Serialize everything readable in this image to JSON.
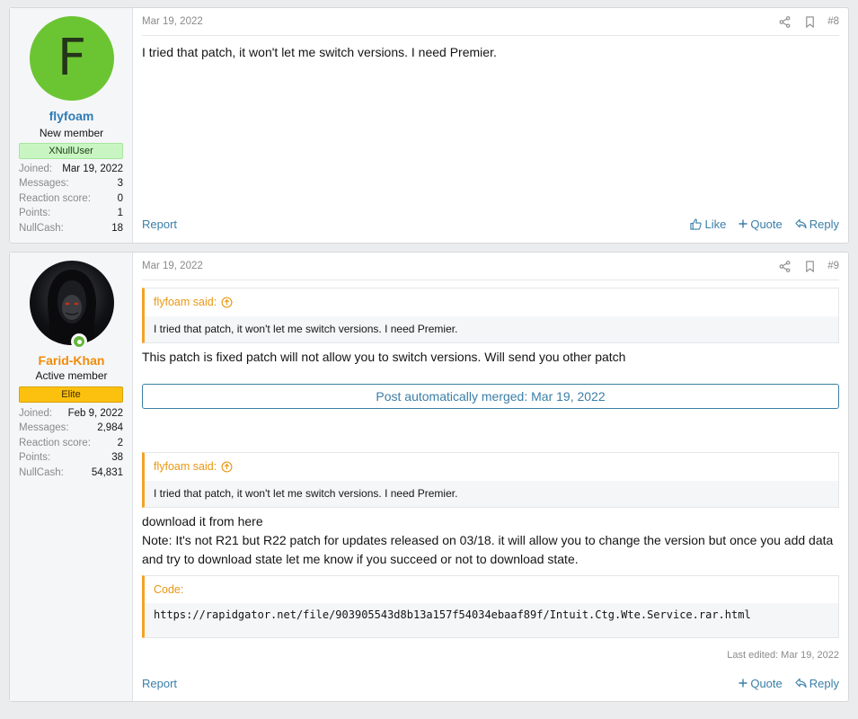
{
  "colors": {
    "link": "#3a7fa8",
    "quote_accent": "#f3a225",
    "avatar_green": "#6bc533",
    "badge_xnull_bg": "#c9f5c3",
    "badge_elite_bg": "#fcc10f",
    "username_blue": "#2f7cb5",
    "username_orange": "#f08c0a"
  },
  "posts": [
    {
      "date": "Mar 19, 2022",
      "number": "#8",
      "user": {
        "avatar_letter": "F",
        "name": "flyfoam",
        "title": "New member",
        "badge": "XNullUser",
        "stats": [
          {
            "label": "Joined:",
            "value": "Mar 19, 2022"
          },
          {
            "label": "Messages:",
            "value": "3"
          },
          {
            "label": "Reaction score:",
            "value": "0"
          },
          {
            "label": "Points:",
            "value": "1"
          },
          {
            "label": "NullCash:",
            "value": "18"
          }
        ]
      },
      "body": "I tried that patch, it won't let me switch versions. I need Premier.",
      "footer": {
        "report": "Report",
        "like": "Like",
        "quote": "Quote",
        "reply": "Reply"
      }
    },
    {
      "date": "Mar 19, 2022",
      "number": "#9",
      "user": {
        "name": "Farid-Khan",
        "title": "Active member",
        "badge": "Elite",
        "stats": [
          {
            "label": "Joined:",
            "value": "Feb 9, 2022"
          },
          {
            "label": "Messages:",
            "value": "2,984"
          },
          {
            "label": "Reaction score:",
            "value": "2"
          },
          {
            "label": "Points:",
            "value": "38"
          },
          {
            "label": "NullCash:",
            "value": "54,831"
          }
        ]
      },
      "quote1": {
        "author": "flyfoam said:",
        "text": "I tried that patch, it won't let me switch versions. I need Premier."
      },
      "reply1": "This patch is fixed patch will not allow you to switch versions. Will send you other patch",
      "merged": "Post automatically merged: Mar 19, 2022",
      "quote2": {
        "author": "flyfoam said:",
        "text": "I tried that patch, it won't let me switch versions. I need Premier."
      },
      "reply2_line1": "download it from here",
      "reply2_line2": "Note: It's not R21 but R22 patch for updates released on 03/18. it will allow you to change the version but once you add data and try to download state let me know if you succeed or not to download state.",
      "code": {
        "label": "Code:",
        "text": "https://rapidgator.net/file/903905543d8b13a157f54034ebaaf89f/Intuit.Ctg.Wte.Service.rar.html"
      },
      "last_edited": "Last edited: Mar 19, 2022",
      "footer": {
        "report": "Report",
        "quote": "Quote",
        "reply": "Reply"
      }
    }
  ]
}
